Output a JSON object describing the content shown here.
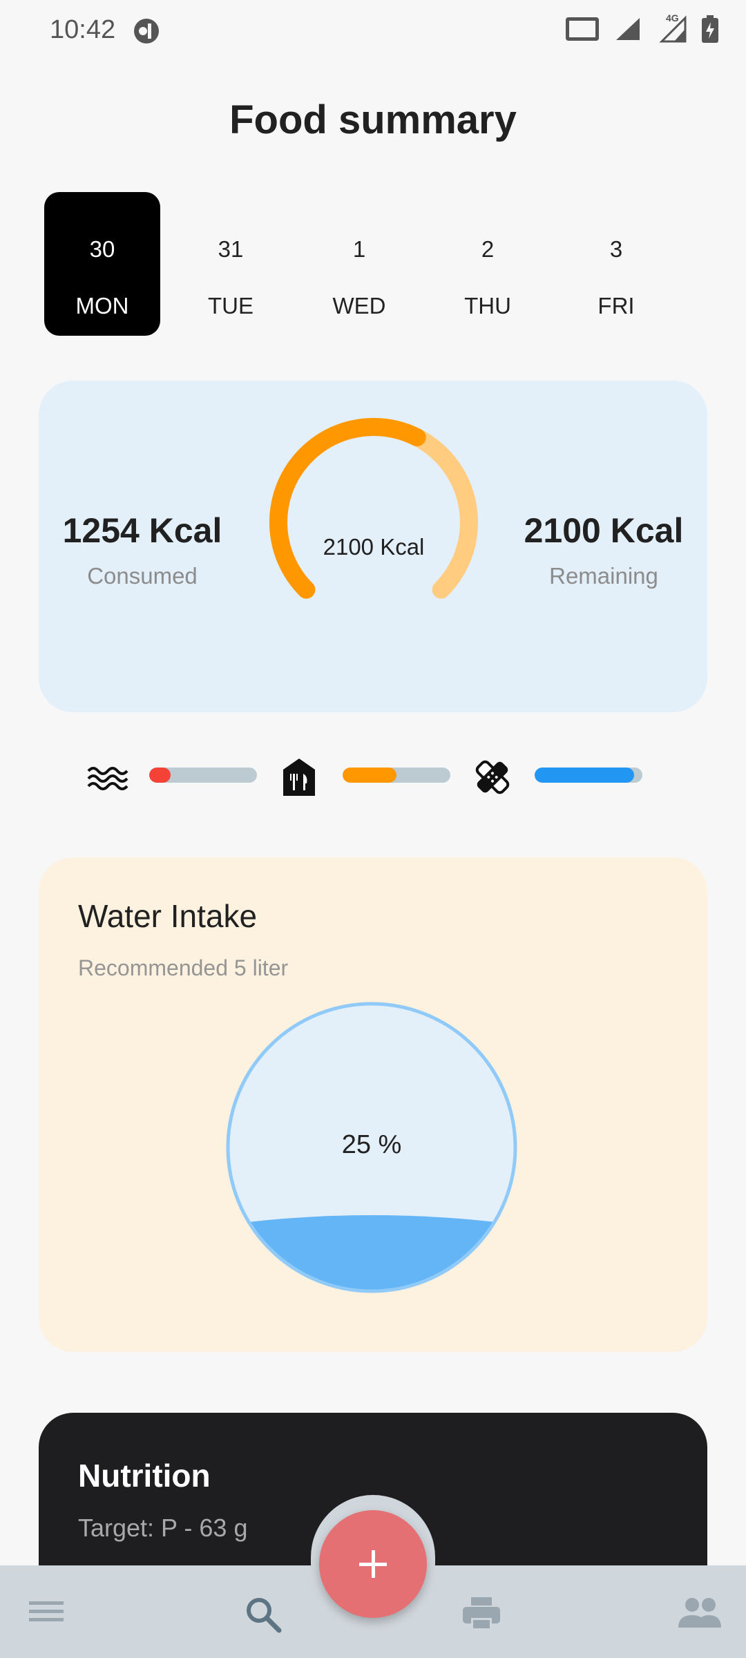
{
  "status_bar": {
    "time": "10:42",
    "network": "4G"
  },
  "header": {
    "title": "Food summary"
  },
  "days": [
    {
      "num": "30",
      "name": "MON",
      "selected": true
    },
    {
      "num": "31",
      "name": "TUE",
      "selected": false
    },
    {
      "num": "1",
      "name": "WED",
      "selected": false
    },
    {
      "num": "2",
      "name": "THU",
      "selected": false
    },
    {
      "num": "3",
      "name": "FRI",
      "selected": false
    }
  ],
  "calories": {
    "consumed_value": "1254 Kcal",
    "consumed_label": "Consumed",
    "goal": "2100 Kcal",
    "remaining_value": "2100 Kcal",
    "remaining_label": "Remaining",
    "progress_fraction": 0.6
  },
  "macros": [
    {
      "icon": "waves-icon",
      "fill_fraction": 0.2,
      "color": "#f44336"
    },
    {
      "icon": "restaurant-icon",
      "fill_fraction": 0.5,
      "color": "#ff9800"
    },
    {
      "icon": "bandage-icon",
      "fill_fraction": 0.92,
      "color": "#2196f3"
    }
  ],
  "water": {
    "title": "Water Intake",
    "subtitle": "Recommended 5 liter",
    "percent_text": "25 %",
    "fill_fraction": 0.25
  },
  "nutrition": {
    "title": "Nutrition",
    "target": "Target: P - 63 g"
  },
  "nav": {
    "items": [
      "menu-icon",
      "search-icon",
      "print-icon",
      "people-icon"
    ],
    "fab_icon": "add-icon"
  },
  "colors": {
    "gauge_active": "#ff9800",
    "gauge_track": "#ffcc80",
    "water": "#64b5f6",
    "fab": "#e57073"
  }
}
